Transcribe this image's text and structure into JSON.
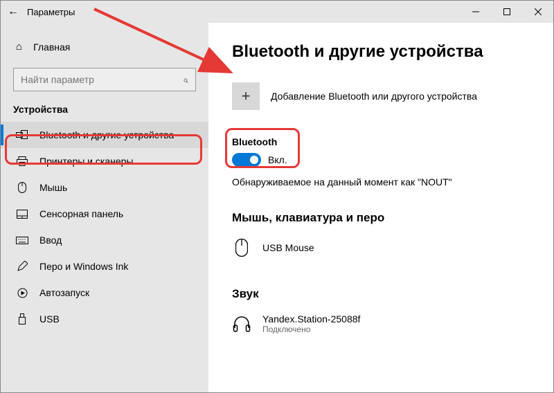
{
  "titlebar": {
    "back": "←",
    "title": "Параметры"
  },
  "sidebar": {
    "home": "Главная",
    "search_placeholder": "Найти параметр",
    "category": "Устройства",
    "items": [
      {
        "label": "Bluetooth и другие устройства",
        "selected": true
      },
      {
        "label": "Принтеры и сканеры"
      },
      {
        "label": "Мышь"
      },
      {
        "label": "Сенсорная панель"
      },
      {
        "label": "Ввод"
      },
      {
        "label": "Перо и Windows Ink"
      },
      {
        "label": "Автозапуск"
      },
      {
        "label": "USB"
      }
    ]
  },
  "main": {
    "title": "Bluetooth и другие устройства",
    "add_device": "Добавление Bluetooth или другого устройства",
    "bt_label": "Bluetooth",
    "bt_state": "Вкл.",
    "discoverable": "Обнаруживаемое на данный момент как \"NOUT\"",
    "section_mouse": "Мышь, клавиатура и перо",
    "device1": {
      "name": "USB Mouse"
    },
    "section_audio": "Звук",
    "device2": {
      "name": "Yandex.Station-25088f",
      "status": "Подключено"
    }
  }
}
